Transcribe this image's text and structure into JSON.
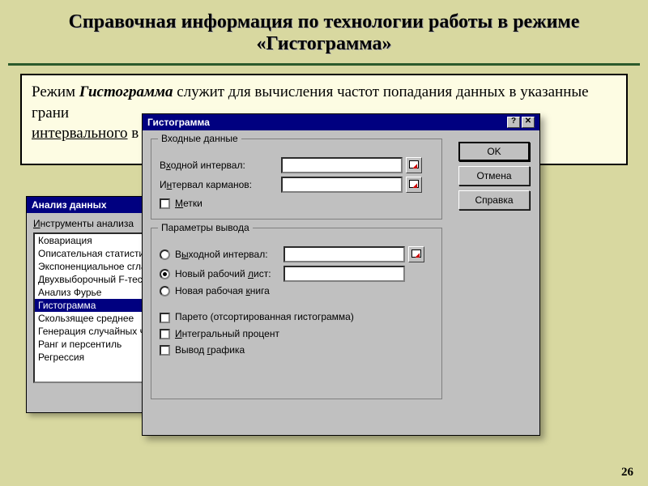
{
  "slide": {
    "title": "Справочная информация по технологии работы в режиме «Гистограмма»",
    "page": "26",
    "desc_pre": "Режим ",
    "desc_em": "Гистограмма",
    "desc_mid": " служит для вычисления частот попадания данных в указанные грани",
    "desc_u": "интервального",
    "desc_post": " в"
  },
  "analysis": {
    "title": "Анализ данных",
    "label": "Инструменты анализа",
    "label_u": "И",
    "items": [
      "Ковариация",
      "Описательная статистик",
      "Экспоненциальное сглаж",
      "Двухвыборочный F-тест",
      "Анализ Фурье",
      "Гистограмма",
      "Скользящее среднее",
      "Генерация случайных чис",
      "Ранг и персентиль",
      "Регрессия"
    ],
    "selected_index": 5
  },
  "hist": {
    "title": "Гистограмма",
    "group_input": "Входные данные",
    "lbl_input_range_pre": "В",
    "lbl_input_range_u": "х",
    "lbl_input_range_post": "одной интервал:",
    "lbl_bin_pre": "И",
    "lbl_bin_u": "н",
    "lbl_bin_post": "тервал карманов:",
    "chk_labels_u": "М",
    "chk_labels_post": "етки",
    "group_output": "Параметры вывода",
    "rad_out_range_pre": "В",
    "rad_out_range_u": "ы",
    "rad_out_range_post": "ходной интервал:",
    "rad_newsheet": "Новый рабочий ",
    "rad_newsheet_u": "л",
    "rad_newsheet_post": "ист:",
    "rad_newbook": "Новая рабочая ",
    "rad_newbook_u": "к",
    "rad_newbook_post": "нига",
    "chk_pareto_pre": "Парето (отсортированная гистограмма)",
    "chk_integral_u": "И",
    "chk_integral_post": "нтегральный процент",
    "chk_chart": "Вывод ",
    "chk_chart_u": "г",
    "chk_chart_post": "рафика",
    "btn_ok": "OK",
    "btn_cancel": "Отмена",
    "btn_help": "Справка"
  }
}
